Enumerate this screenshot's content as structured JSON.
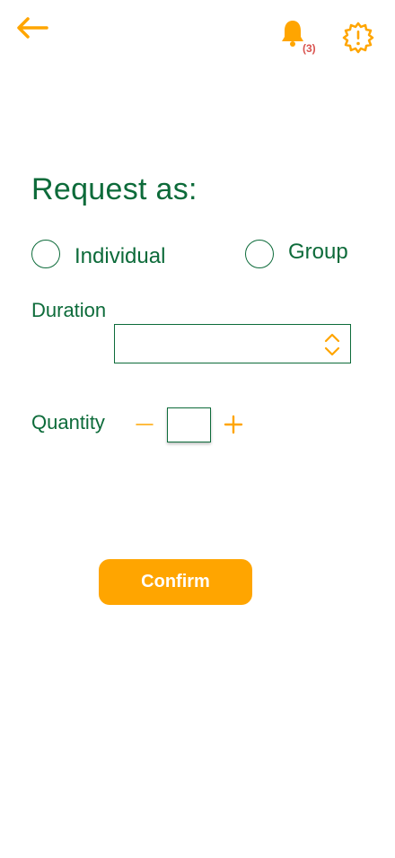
{
  "header": {
    "back_icon": "arrow-left-icon",
    "notifications": {
      "icon": "bell-icon",
      "count": "(3)"
    },
    "settings_icon": "gear-alert-icon"
  },
  "form": {
    "title": "Request as:",
    "options": [
      {
        "label": "Individual",
        "selected": false
      },
      {
        "label": "Group",
        "selected": false
      }
    ],
    "duration": {
      "label": "Duration",
      "value": ""
    },
    "quantity": {
      "label": "Quantity",
      "value": ""
    },
    "confirm_label": "Confirm"
  },
  "colors": {
    "primary": "#0d6b3a",
    "accent": "#ffa500",
    "badge": "#d9534f"
  }
}
